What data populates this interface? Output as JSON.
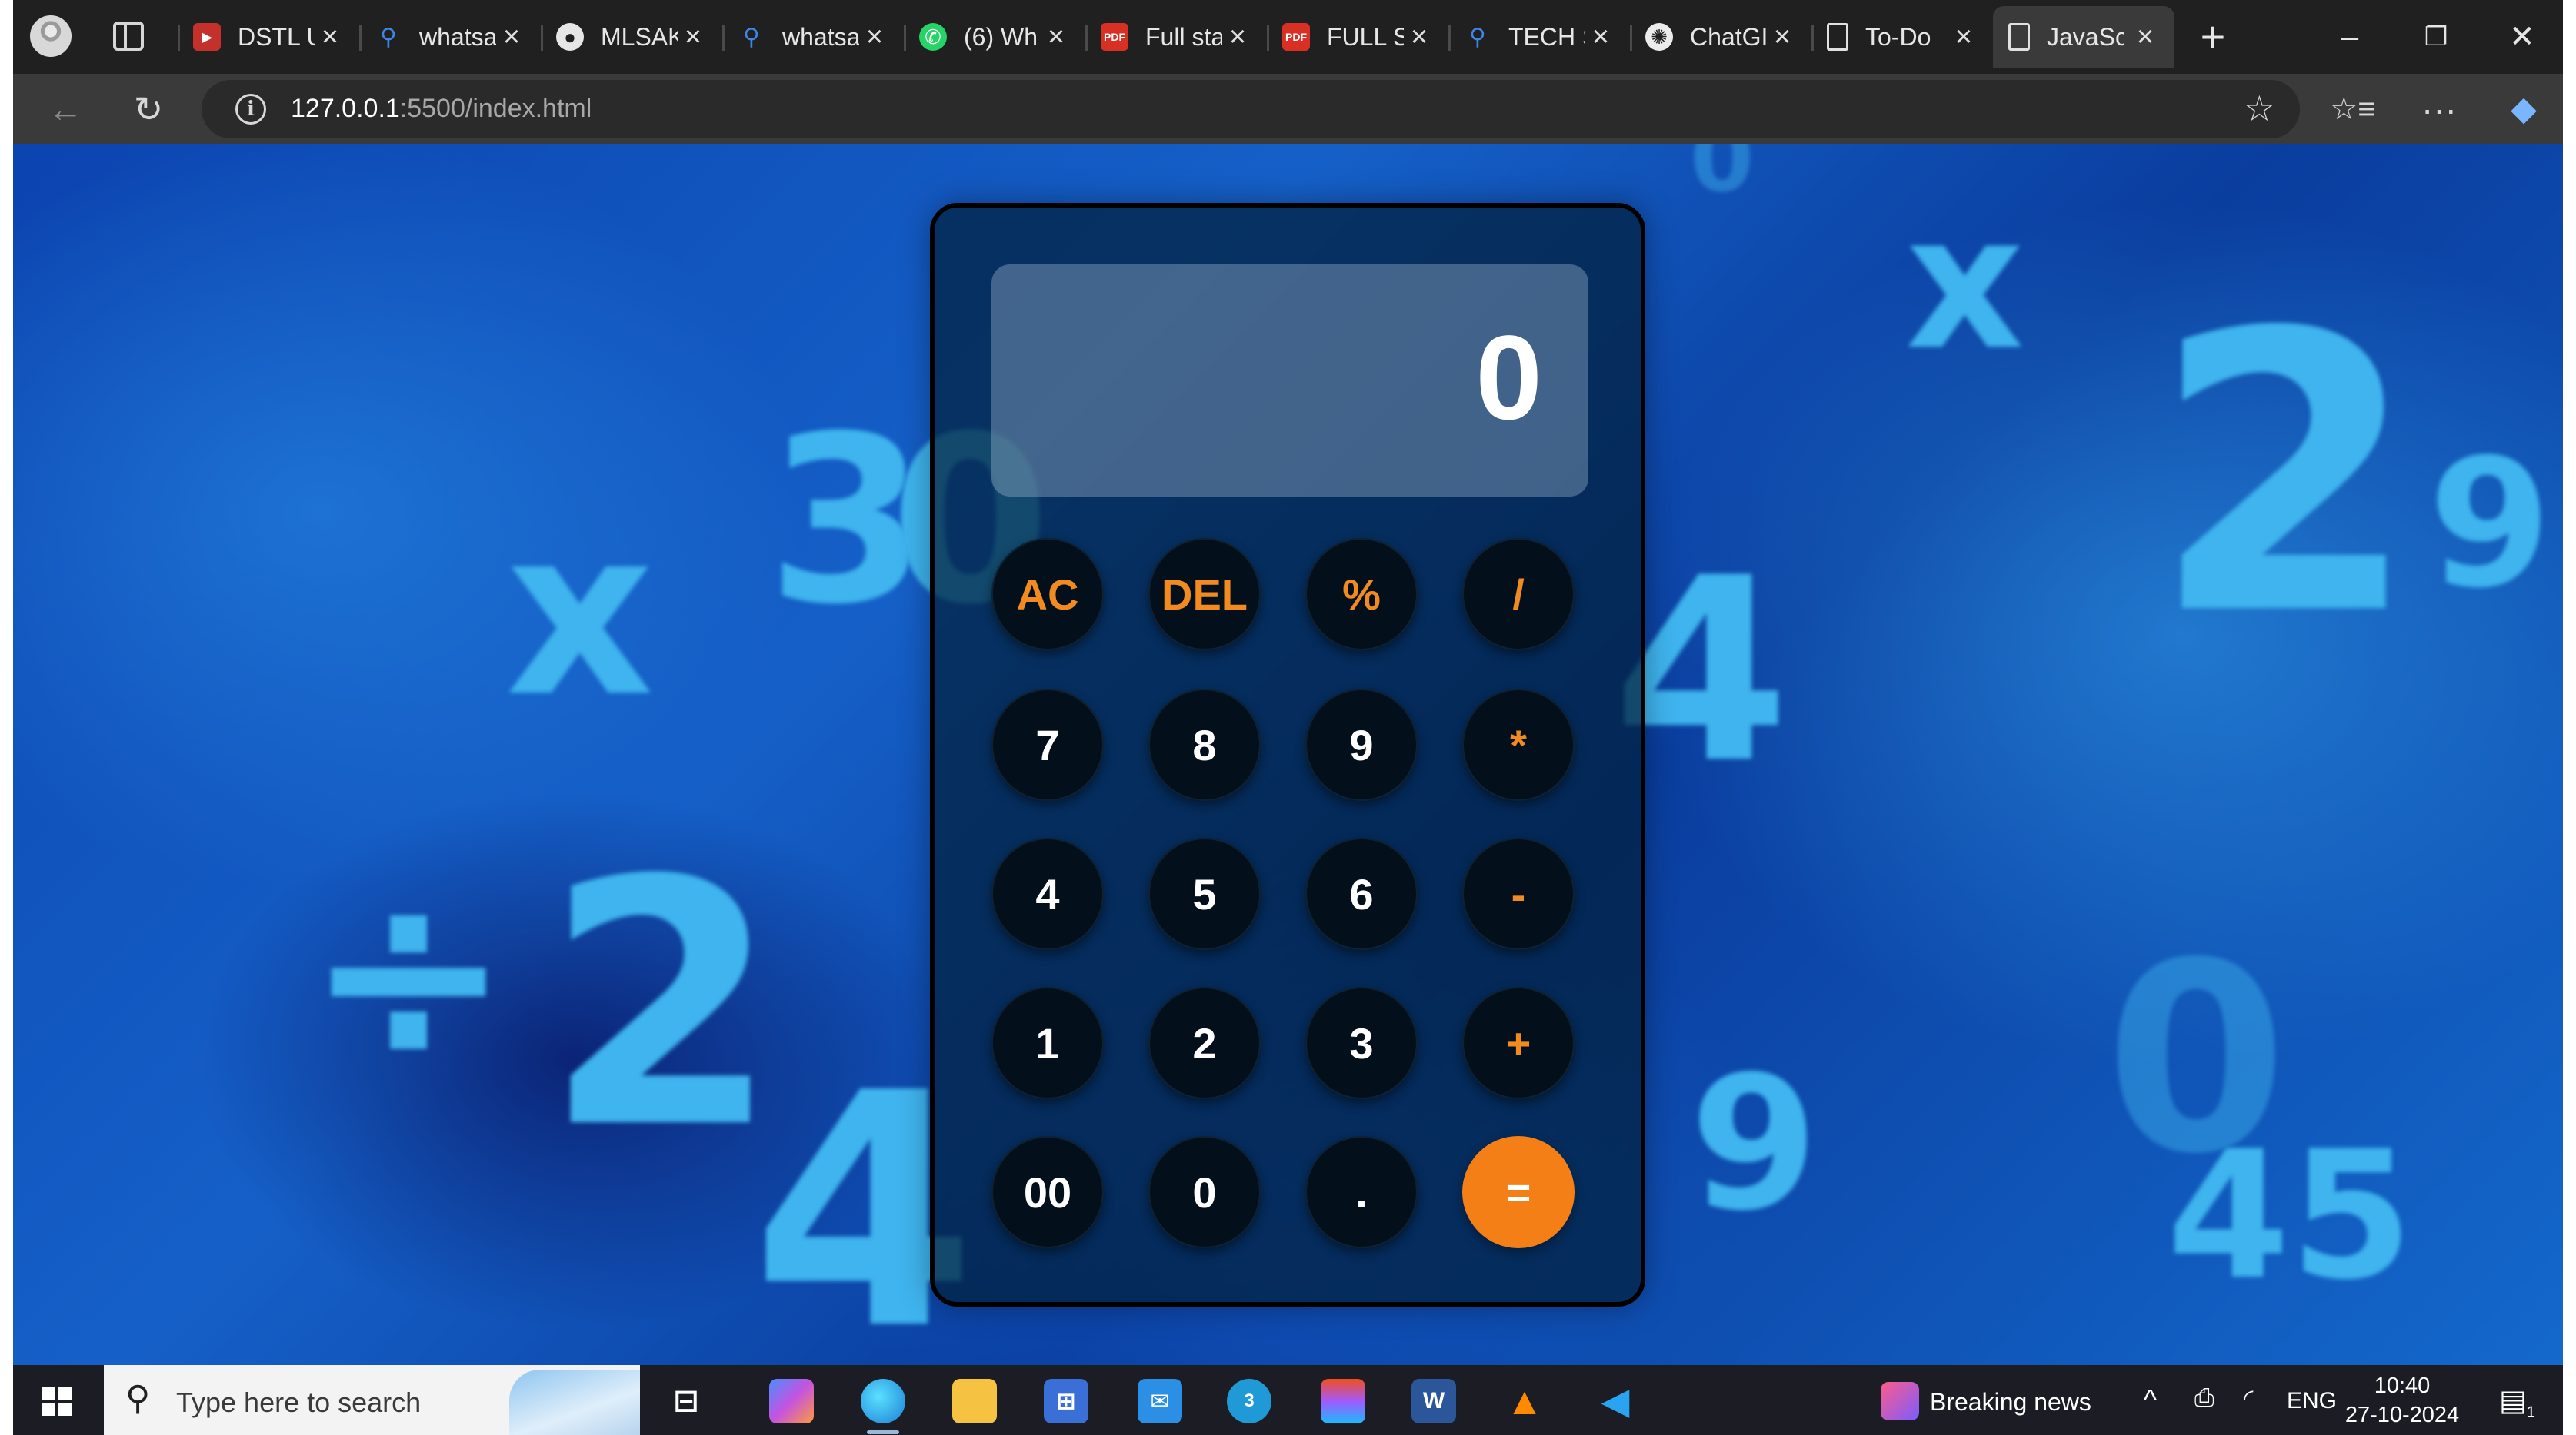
{
  "browser": {
    "tabs": [
      {
        "title": "DSTL U",
        "icon": "youtube-icon"
      },
      {
        "title": "whatsa",
        "icon": "search-icon"
      },
      {
        "title": "MLSAK",
        "icon": "github-icon"
      },
      {
        "title": "whatsa",
        "icon": "search-icon"
      },
      {
        "title": "(6) Wh",
        "icon": "whatsapp-icon"
      },
      {
        "title": "Full sta",
        "icon": "pdf-icon"
      },
      {
        "title": "FULL S",
        "icon": "pdf-icon"
      },
      {
        "title": "TECH S",
        "icon": "search-icon"
      },
      {
        "title": "ChatGI",
        "icon": "chatgpt-icon"
      },
      {
        "title": "To-Do",
        "icon": "document-icon"
      },
      {
        "title": "JavaSc",
        "icon": "document-icon",
        "active": true
      }
    ],
    "address": {
      "host": "127.0.0.1",
      "path": ":5500/index.html"
    }
  },
  "calculator": {
    "display": "0",
    "keys": [
      {
        "label": "AC",
        "kind": "op"
      },
      {
        "label": "DEL",
        "kind": "op"
      },
      {
        "label": "%",
        "kind": "op"
      },
      {
        "label": "/",
        "kind": "op"
      },
      {
        "label": "7",
        "kind": "num"
      },
      {
        "label": "8",
        "kind": "num"
      },
      {
        "label": "9",
        "kind": "num"
      },
      {
        "label": "*",
        "kind": "op"
      },
      {
        "label": "4",
        "kind": "num"
      },
      {
        "label": "5",
        "kind": "num"
      },
      {
        "label": "6",
        "kind": "num"
      },
      {
        "label": "-",
        "kind": "op"
      },
      {
        "label": "1",
        "kind": "num"
      },
      {
        "label": "2",
        "kind": "num"
      },
      {
        "label": "3",
        "kind": "num"
      },
      {
        "label": "+",
        "kind": "op"
      },
      {
        "label": "00",
        "kind": "num"
      },
      {
        "label": "0",
        "kind": "num"
      },
      {
        "label": ".",
        "kind": "num"
      },
      {
        "label": "=",
        "kind": "eq"
      }
    ],
    "colors": {
      "accent": "#f57f17",
      "operator_text": "#f08a21"
    }
  },
  "background_numbers": [
    "0",
    "x",
    "2",
    "9",
    "3",
    "0",
    "x",
    "÷",
    "2",
    "4",
    "9",
    "0",
    "45",
    "4"
  ],
  "taskbar": {
    "search_placeholder": "Type here to search",
    "news": "Breaking news",
    "language": "ENG",
    "time": "10:40",
    "date": "27-10-2024",
    "notification_count": "1",
    "chat_badge": "3"
  }
}
